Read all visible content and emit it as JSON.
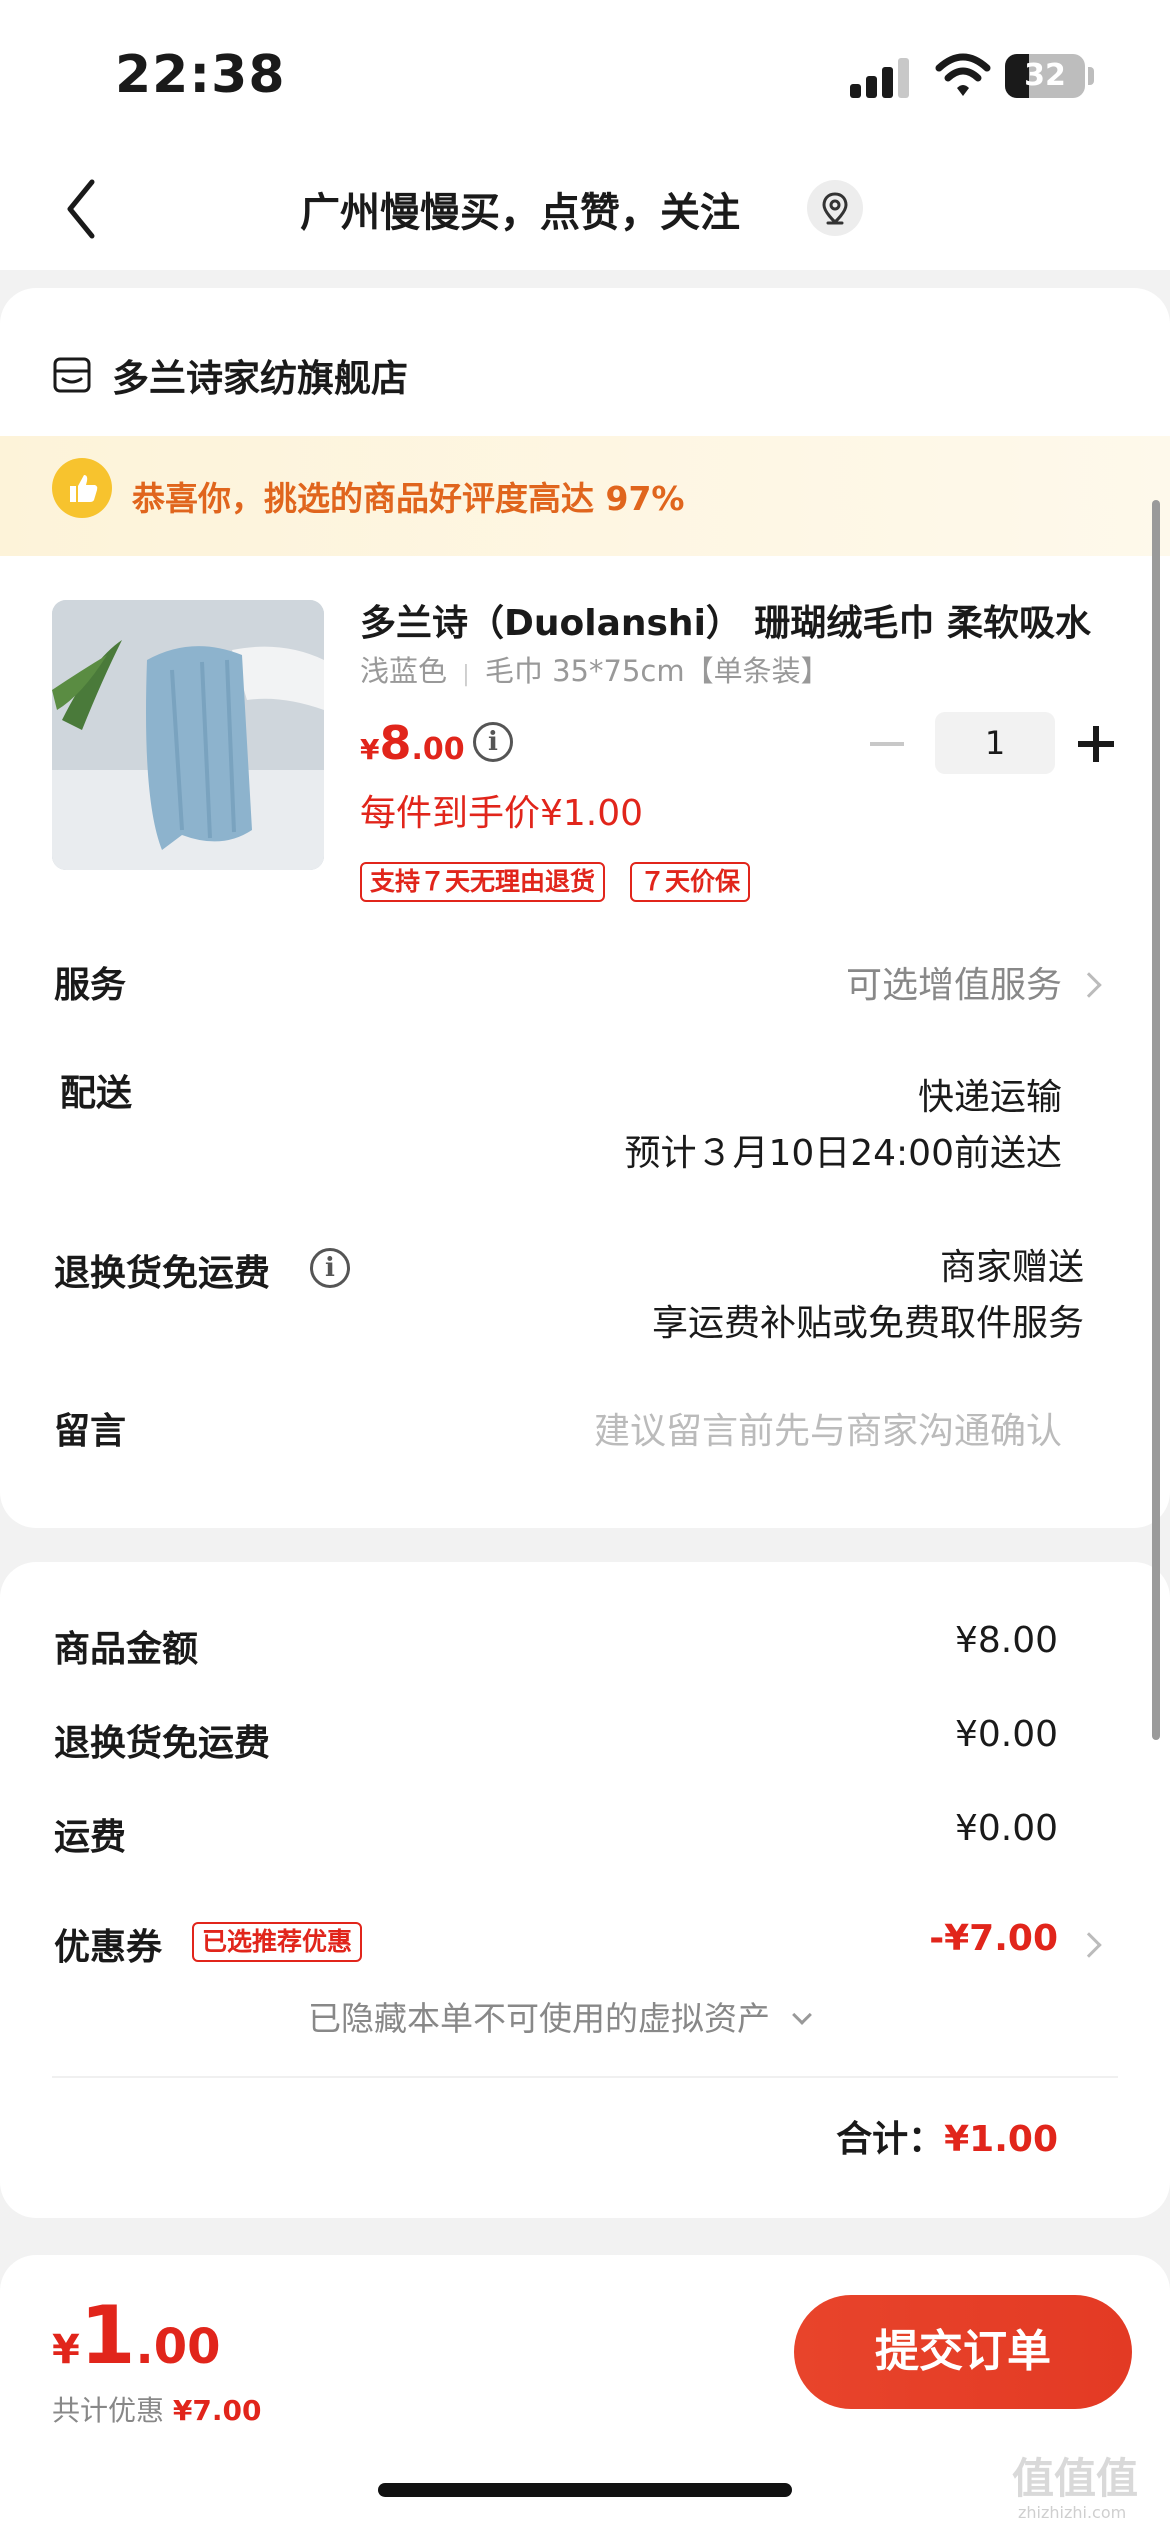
{
  "status_bar": {
    "time": "22:38",
    "battery": "32"
  },
  "nav": {
    "title": "广州慢慢买，点赞，关注"
  },
  "shop": {
    "name": "多兰诗家纺旗舰店"
  },
  "banner": {
    "text": "恭喜你，挑选的商品好评度高达 97%"
  },
  "product": {
    "title": "多兰诗（Duolanshi） 珊瑚绒毛巾 柔软吸水",
    "color": "浅蓝色",
    "spec": "毛巾 35*75cm【单条装】",
    "price_currency": "¥",
    "price_int": "8",
    "price_dec": ".00",
    "quantity": "1",
    "unit_price": "每件到手价¥1.00",
    "tags": [
      "支持７天无理由退货",
      "７天价保"
    ]
  },
  "rows": {
    "service_label": "服务",
    "service_value": "可选增值服务",
    "delivery_label": "配送",
    "delivery_method": "快递运输",
    "delivery_eta": "预计３月10日24:00前送达",
    "return_label": "退换货免运费",
    "return_value_1": "商家赠送",
    "return_value_2": "享运费补贴或免费取件服务",
    "message_label": "留言",
    "message_placeholder": "建议留言前先与商家沟通确认"
  },
  "summary": {
    "goods_label": "商品金额",
    "goods_value": "¥8.00",
    "return_fee_label": "退换货免运费",
    "return_fee_value": "¥0.00",
    "shipping_label": "运费",
    "shipping_value": "¥0.00",
    "coupon_label": "优惠券",
    "coupon_tag": "已选推荐优惠",
    "coupon_value": "-¥7.00",
    "hidden_assets": "已隐藏本单不可使用的虚拟资产",
    "total_label": "合计：",
    "total_value": "¥1.00"
  },
  "bottom": {
    "currency": "¥",
    "total_int": "1",
    "total_dec": ".00",
    "saving_label": "共计优惠",
    "saving_value": "¥7.00",
    "submit_label": "提交订单"
  },
  "watermark": {
    "main": "值值值",
    "sub": "zhizhizhi.com"
  },
  "colors": {
    "accent": "#e1251b",
    "banner_text": "#e0651d"
  }
}
